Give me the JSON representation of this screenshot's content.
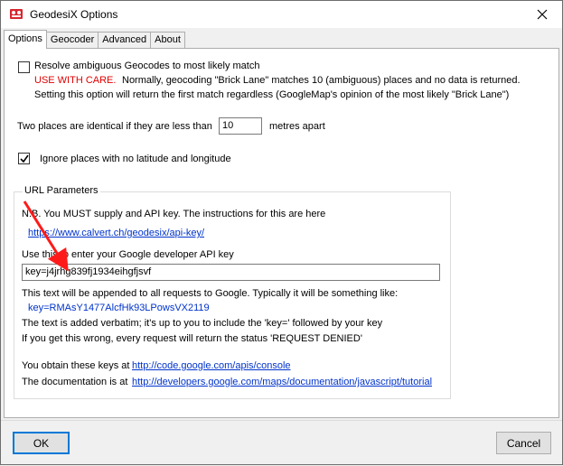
{
  "window": {
    "title": "GeodesiX Options"
  },
  "tabs": [
    {
      "label": "Options",
      "active": true
    },
    {
      "label": "Geocoder",
      "active": false
    },
    {
      "label": "Advanced",
      "active": false
    },
    {
      "label": "About",
      "active": false
    }
  ],
  "options": {
    "resolve_checkbox": {
      "checked": false,
      "label": "Resolve ambiguous Geocodes to most likely match"
    },
    "caution_label": "USE WITH CARE.",
    "caution_text": "Normally, geocoding \"Brick Lane\" matches 10 (ambiguous) places and no data is returned.",
    "caution_text2": "Setting this option will return the first match regardless (GoogleMap's opinion of the most likely \"Brick Lane\")",
    "identical_prefix": "Two places are identical if they are less than",
    "identical_value": "10",
    "identical_suffix": "metres apart",
    "ignore_checkbox": {
      "checked": true,
      "label": "Ignore places with no latitude and longitude"
    }
  },
  "url_params": {
    "legend": "URL Parameters",
    "nb_text": "N.B.  You MUST supply and API key. The instructions for this are here",
    "instructions_link": "https://www.calvert.ch/geodesix/api-key/",
    "use_prompt": "Use this to enter your Google developer API key",
    "api_key_value": "key=j4jrhg839fj1934eihgfjsvf",
    "appended_text": "This text will be appended to all requests to Google. Typically it will be something like:",
    "example_key": "key=RMAsY1477AlcfHk93LPowsVX2119",
    "verbatim_text": "The text is added verbatim; it's up to you to include the 'key='  followed by your key",
    "wrong_text": "If you get this wrong, every request will return the status 'REQUEST DENIED'",
    "obtain_prefix": "You obtain these keys at",
    "obtain_link": "http://code.google.com/apis/console",
    "docs_prefix": "The documentation is at",
    "docs_link": "http://developers.google.com/maps/documentation/javascript/tutorial"
  },
  "buttons": {
    "ok": "OK",
    "cancel": "Cancel"
  },
  "colors": {
    "caution": "#e00000",
    "link": "#0033cc",
    "annotation_arrow": "#ff1a1a"
  },
  "icons": {
    "app": "geodesix-app-icon",
    "close": "close-icon",
    "checkmark": "checkmark-icon",
    "annotation": "red-arrow-annotation"
  }
}
